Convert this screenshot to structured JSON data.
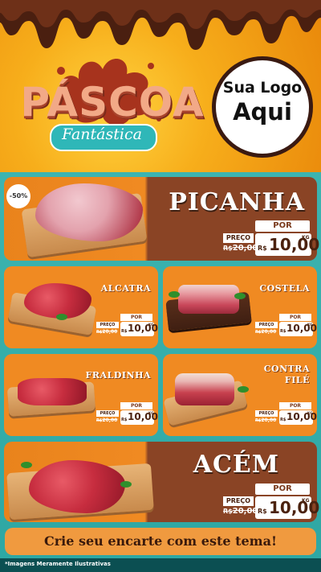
{
  "header": {
    "title": "PÁSCOA",
    "subtitle": "Fantástica",
    "logo_line1": "Sua Logo",
    "logo_line2": "Aqui"
  },
  "colors": {
    "orange": "#f08a22",
    "brown": "#8b4727",
    "teal": "#2ea7a3",
    "chocolate": "#4b220f"
  },
  "products": [
    {
      "name": "PICANHA",
      "badge": "-50%",
      "por": "POR",
      "preco": "PREÇO",
      "old_prefix": "R$",
      "old_price": "20,00",
      "currency": "R$",
      "price": "10,00",
      "unit": "KG"
    },
    {
      "name": "ALCATRA",
      "por": "POR",
      "preco": "PREÇO",
      "old_prefix": "R$",
      "old_price": "20,00",
      "currency": "R$",
      "price": "10,00",
      "unit": "KG"
    },
    {
      "name": "COSTELA",
      "por": "POR",
      "preco": "PREÇO",
      "old_prefix": "R$",
      "old_price": "20,00",
      "currency": "R$",
      "price": "10,00",
      "unit": "KG"
    },
    {
      "name": "FRALDINHA",
      "por": "POR",
      "preco": "PREÇO",
      "old_prefix": "R$",
      "old_price": "20,00",
      "currency": "R$",
      "price": "10,00",
      "unit": "KG"
    },
    {
      "name_line1": "CONTRA",
      "name_line2": "FILÉ",
      "por": "POR",
      "preco": "PREÇO",
      "old_prefix": "R$",
      "old_price": "20,00",
      "currency": "R$",
      "price": "10,00",
      "unit": "KG"
    },
    {
      "name": "ACÉM",
      "por": "POR",
      "preco": "PREÇO",
      "old_prefix": "R$",
      "old_price": "20,00",
      "currency": "R$",
      "price": "10,00",
      "unit": "KG"
    }
  ],
  "cta": "Crie seu encarte com este tema!",
  "footer_note": "*Imagens Meramente Ilustrativas"
}
